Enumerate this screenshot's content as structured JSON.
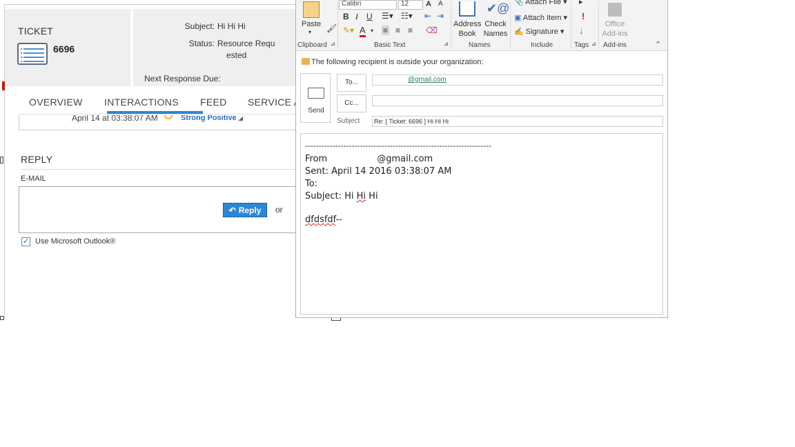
{
  "ticket": {
    "title": "TICKET",
    "number": "6696",
    "subject_label": "Subject:",
    "subject_value": "Hi Hi Hi",
    "status_label": "Status:",
    "status_value_line1": "Resource Requ",
    "status_value_line2": "ested",
    "next_response_label": "Next Response Due:",
    "tabs": [
      "OVERVIEW",
      "INTERACTIONS",
      "FEED",
      "SERVICE A"
    ],
    "active_tab": "INTERACTIONS",
    "feed_date": "April 14 at 03:38:07 AM",
    "feed_sentiment": "Strong Positive",
    "reply_title": "REPLY",
    "email_label": "E-MAIL",
    "reply_button": "Reply",
    "or_text": "or",
    "use_outlook_label": "Use Microsoft Outlook®",
    "use_outlook_checked": true
  },
  "outlook": {
    "ribbon": {
      "paste": "Paste",
      "font_name": "Calibri",
      "font_size": "12",
      "address_book": "Address Book",
      "address_book_l1": "Address",
      "address_book_l2": "Book",
      "check_names_l1": "Check",
      "check_names_l2": "Names",
      "attach_file": "Attach File",
      "attach_item": "Attach Item",
      "signature": "Signature",
      "office_addins_l1": "Office",
      "office_addins_l2": "Add-ins",
      "groups": {
        "clipboard": "Clipboard",
        "basic_text": "Basic Text",
        "names": "Names",
        "include": "Include",
        "tags": "Tags",
        "addins": "Add-ins"
      }
    },
    "notice": "The following recipient is outside your organization:",
    "send": "Send",
    "to_button": "To...",
    "cc_button": "Cc...",
    "to_value": "@gmail.com",
    "cc_value": "",
    "subject_label": "Subject",
    "subject_value": "Re: [ Ticket: 6696 ] Hi Hi Hi",
    "body": {
      "separator": "--------------------------------------------------------------------",
      "from_label": "From",
      "from_value": "@gmail.com",
      "sent": "Sent: April 14 2016 03:38:07 AM",
      "to": "To:",
      "subject_prefix": "Subject: Hi ",
      "subject_word": "Hi",
      "subject_suffix": " Hi",
      "text_word": "dfdsfdf",
      "text_suffix": "--"
    }
  },
  "colors": {
    "accent": "#2b87d8",
    "header_bg": "#efefef",
    "link_green": "#2f7d66"
  }
}
